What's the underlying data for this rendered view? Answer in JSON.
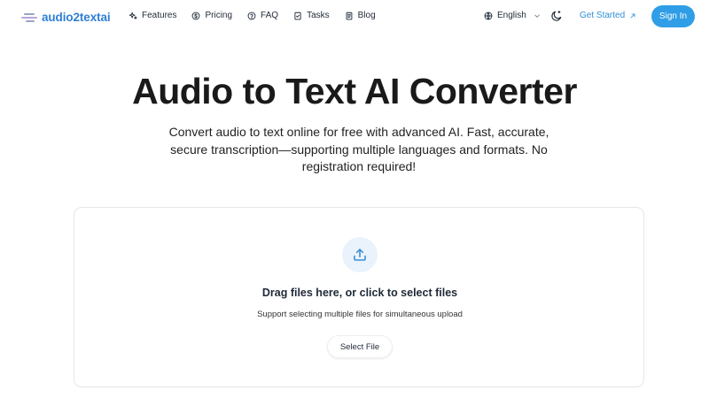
{
  "header": {
    "logo_text": "audio2textai",
    "nav": [
      {
        "label": "Features",
        "icon": "sparkles-icon"
      },
      {
        "label": "Pricing",
        "icon": "dollar-circle-icon"
      },
      {
        "label": "FAQ",
        "icon": "question-circle-icon"
      },
      {
        "label": "Tasks",
        "icon": "clipboard-check-icon"
      },
      {
        "label": "Blog",
        "icon": "document-icon"
      }
    ],
    "language": "English",
    "get_started": "Get Started",
    "sign_in": "Sign In"
  },
  "hero": {
    "title": "Audio to Text AI Converter",
    "subtitle": "Convert audio to text online for free with advanced AI. Fast, accurate, secure transcription—supporting multiple languages and formats. No registration required!"
  },
  "upload": {
    "title": "Drag files here, or click to select files",
    "subtitle": "Support selecting multiple files for simultaneous upload",
    "button": "Select File"
  },
  "colors": {
    "brand": "#2f7fd6",
    "primary_button": "#2f9ee6",
    "upload_circle": "#eaf3fb"
  }
}
